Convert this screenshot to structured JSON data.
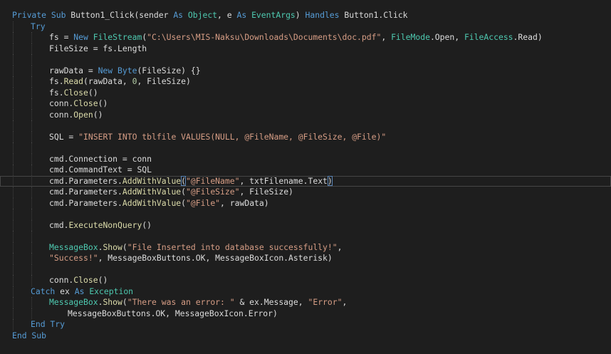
{
  "editor": {
    "language": "VB.NET",
    "theme_colors": {
      "background": "#1e1e1e",
      "plain": "#dcdcdc",
      "keyword": "#569cd6",
      "string": "#d69d85",
      "number": "#b5cea8",
      "type": "#4ec9b0",
      "method": "#dcdcaa",
      "current_line_border": "#464646"
    },
    "current_line": 16,
    "lines": [
      {
        "indent": 0,
        "tokens": [
          [
            "kw",
            "Private Sub "
          ],
          [
            "p",
            "Button1_Click(sender "
          ],
          [
            "kw",
            "As "
          ],
          [
            "type",
            "Object"
          ],
          [
            "p",
            ", e "
          ],
          [
            "kw",
            "As "
          ],
          [
            "type",
            "EventArgs"
          ],
          [
            "p",
            ") "
          ],
          [
            "kw",
            "Handles "
          ],
          [
            "p",
            "Button1.Click"
          ]
        ]
      },
      {
        "indent": 1,
        "tokens": [
          [
            "kw",
            "Try"
          ]
        ]
      },
      {
        "indent": 2,
        "tokens": [
          [
            "p",
            "fs = "
          ],
          [
            "kw",
            "New "
          ],
          [
            "type",
            "FileStream"
          ],
          [
            "p",
            "("
          ],
          [
            "str",
            "\"C:\\Users\\MIS-Naksu\\Downloads\\Documents\\doc.pdf\""
          ],
          [
            "p",
            ", "
          ],
          [
            "type",
            "FileMode"
          ],
          [
            "p",
            ".Open, "
          ],
          [
            "type",
            "FileAccess"
          ],
          [
            "p",
            ".Read)"
          ]
        ]
      },
      {
        "indent": 2,
        "tokens": [
          [
            "p",
            "FileSize = fs.Length"
          ]
        ]
      },
      {
        "indent": 2,
        "tokens": []
      },
      {
        "indent": 2,
        "tokens": [
          [
            "p",
            "rawData = "
          ],
          [
            "kw",
            "New "
          ],
          [
            "kw",
            "Byte"
          ],
          [
            "p",
            "(FileSize) {}"
          ]
        ]
      },
      {
        "indent": 2,
        "tokens": [
          [
            "p",
            "fs."
          ],
          [
            "fn",
            "Read"
          ],
          [
            "p",
            "(rawData, "
          ],
          [
            "num",
            "0"
          ],
          [
            "p",
            ", FileSize)"
          ]
        ]
      },
      {
        "indent": 2,
        "tokens": [
          [
            "p",
            "fs."
          ],
          [
            "fn",
            "Close"
          ],
          [
            "p",
            "()"
          ]
        ]
      },
      {
        "indent": 2,
        "tokens": [
          [
            "p",
            "conn."
          ],
          [
            "fn",
            "Close"
          ],
          [
            "p",
            "()"
          ]
        ]
      },
      {
        "indent": 2,
        "tokens": [
          [
            "p",
            "conn."
          ],
          [
            "fn",
            "Open"
          ],
          [
            "p",
            "()"
          ]
        ]
      },
      {
        "indent": 2,
        "tokens": []
      },
      {
        "indent": 2,
        "tokens": [
          [
            "p",
            "SQL = "
          ],
          [
            "str",
            "\"INSERT INTO tblfile VALUES(NULL, @FileName, @FileSize, @File)\""
          ]
        ]
      },
      {
        "indent": 2,
        "tokens": []
      },
      {
        "indent": 2,
        "tokens": [
          [
            "p",
            "cmd.Connection = conn"
          ]
        ]
      },
      {
        "indent": 2,
        "tokens": [
          [
            "p",
            "cmd.CommandText = SQL"
          ]
        ]
      },
      {
        "indent": 2,
        "tokens": [
          [
            "p",
            "cmd.Parameters."
          ],
          [
            "fn",
            "AddWithValue"
          ],
          [
            "brace",
            "("
          ],
          [
            "str",
            "\"@FileName\""
          ],
          [
            "p",
            ", txtFilename.Text"
          ],
          [
            "brace",
            ")"
          ]
        ]
      },
      {
        "indent": 2,
        "tokens": [
          [
            "p",
            "cmd.Parameters."
          ],
          [
            "fn",
            "AddWithValue"
          ],
          [
            "p",
            "("
          ],
          [
            "str",
            "\"@FileSize\""
          ],
          [
            "p",
            ", FileSize)"
          ]
        ]
      },
      {
        "indent": 2,
        "tokens": [
          [
            "p",
            "cmd.Parameters."
          ],
          [
            "fn",
            "AddWithValue"
          ],
          [
            "p",
            "("
          ],
          [
            "str",
            "\"@File\""
          ],
          [
            "p",
            ", rawData)"
          ]
        ]
      },
      {
        "indent": 2,
        "tokens": []
      },
      {
        "indent": 2,
        "tokens": [
          [
            "p",
            "cmd."
          ],
          [
            "fn",
            "ExecuteNonQuery"
          ],
          [
            "p",
            "()"
          ]
        ]
      },
      {
        "indent": 2,
        "tokens": []
      },
      {
        "indent": 2,
        "tokens": [
          [
            "type",
            "MessageBox"
          ],
          [
            "p",
            "."
          ],
          [
            "fn",
            "Show"
          ],
          [
            "p",
            "("
          ],
          [
            "str",
            "\"File Inserted into database successfully!\""
          ],
          [
            "p",
            ","
          ]
        ]
      },
      {
        "indent": 2,
        "tokens": [
          [
            "str",
            "\"Success!\""
          ],
          [
            "p",
            ", MessageBoxButtons.OK, MessageBoxIcon.Asterisk)"
          ]
        ]
      },
      {
        "indent": 2,
        "tokens": []
      },
      {
        "indent": 2,
        "tokens": [
          [
            "p",
            "conn."
          ],
          [
            "fn",
            "Close"
          ],
          [
            "p",
            "()"
          ]
        ]
      },
      {
        "indent": 1,
        "tokens": [
          [
            "kw",
            "Catch "
          ],
          [
            "p",
            "ex "
          ],
          [
            "kw",
            "As "
          ],
          [
            "type",
            "Exception"
          ]
        ]
      },
      {
        "indent": 2,
        "tokens": [
          [
            "type",
            "MessageBox"
          ],
          [
            "p",
            "."
          ],
          [
            "fn",
            "Show"
          ],
          [
            "p",
            "("
          ],
          [
            "str",
            "\"There was an error: \""
          ],
          [
            "p",
            " & ex.Message, "
          ],
          [
            "str",
            "\"Error\""
          ],
          [
            "p",
            ","
          ]
        ]
      },
      {
        "indent": 3,
        "tokens": [
          [
            "p",
            "MessageBoxButtons.OK, MessageBoxIcon.Error)"
          ]
        ]
      },
      {
        "indent": 1,
        "tokens": [
          [
            "kw",
            "End Try"
          ]
        ]
      },
      {
        "indent": 0,
        "tokens": [
          [
            "kw",
            "End Sub"
          ]
        ]
      }
    ]
  }
}
